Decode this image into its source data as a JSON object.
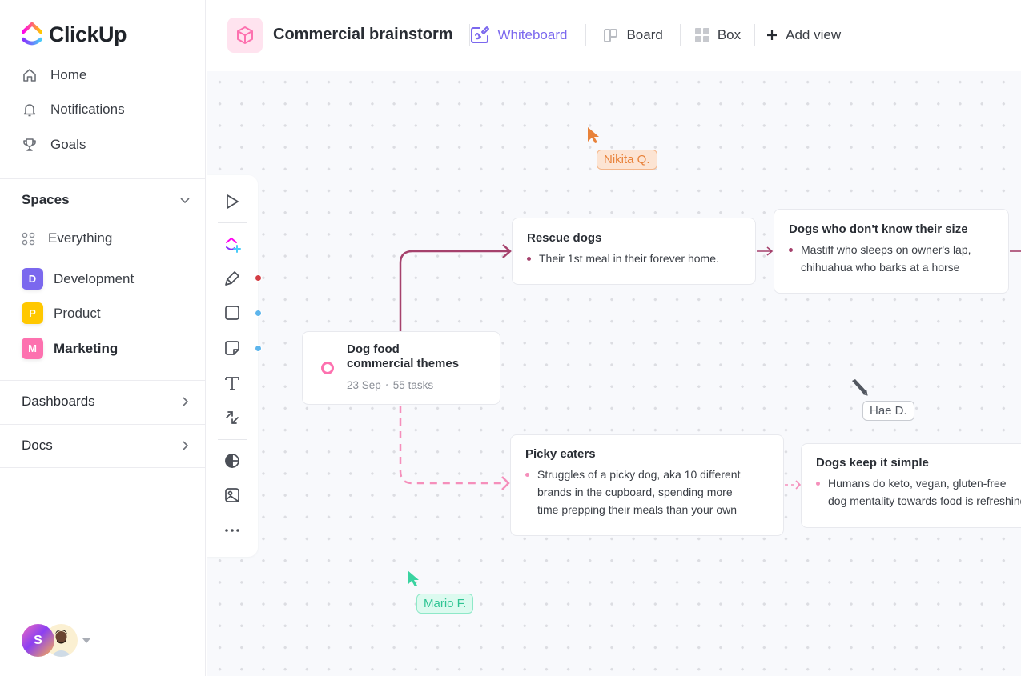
{
  "brand": {
    "name": "ClickUp"
  },
  "sidebar": {
    "nav": [
      {
        "label": "Home",
        "icon": "home-icon"
      },
      {
        "label": "Notifications",
        "icon": "bell-icon"
      },
      {
        "label": "Goals",
        "icon": "trophy-icon"
      }
    ],
    "spaces_heading": "Spaces",
    "everything_label": "Everything",
    "spaces": [
      {
        "letter": "D",
        "label": "Development",
        "color": "#7b68ee"
      },
      {
        "letter": "P",
        "label": "Product",
        "color": "#ffc800"
      },
      {
        "letter": "M",
        "label": "Marketing",
        "color": "#fd71af",
        "active": true
      }
    ],
    "sections": [
      {
        "label": "Dashboards"
      },
      {
        "label": "Docs"
      }
    ],
    "user_avatar_letter": "S"
  },
  "header": {
    "title": "Commercial brainstorm",
    "views": [
      {
        "label": "Whiteboard",
        "active": true
      },
      {
        "label": "Board"
      },
      {
        "label": "Box"
      }
    ],
    "add_view_label": "Add view"
  },
  "toolbar": {
    "tools": [
      "select",
      "clickup-add",
      "marker",
      "rectangle",
      "sticky-note",
      "text",
      "connector",
      "globe",
      "image",
      "more"
    ],
    "indicator_colors": {
      "marker": "#d33d44",
      "rectangle": "#5db5ec",
      "sticky-note": "#5db5ec"
    }
  },
  "whiteboard": {
    "root": {
      "title_line1": "Dog food",
      "title_line2": "commercial themes",
      "date": "23 Sep",
      "tasks": "55 tasks"
    },
    "cards": [
      {
        "id": "rescue",
        "title": "Rescue dogs",
        "lines": [
          "Their 1st meal in their forever home."
        ],
        "bullet_color": "#a5416c"
      },
      {
        "id": "size",
        "title": "Dogs who don't know their size",
        "lines": [
          "Mastiff who sleeps on owner's lap,",
          "chihuahua who barks at a horse"
        ],
        "bullet_color": "#a5416c"
      },
      {
        "id": "picky",
        "title": "Picky eaters",
        "lines": [
          "Struggles of a picky dog, aka 10 different",
          "brands in the cupboard, spending more",
          "time prepping their meals than your own"
        ],
        "bullet_color": "#f58fbb"
      },
      {
        "id": "simple",
        "title": "Dogs keep it simple",
        "lines": [
          "Humans do keto, vegan, gluten-free",
          "dog mentality towards food is refreshing"
        ],
        "bullet_color": "#f58fbb"
      }
    ],
    "collaborators": [
      {
        "name": "Nikita Q.",
        "color": "#e8823a",
        "bg": "#fce4d3"
      },
      {
        "name": "Hae D.",
        "color": "#525760",
        "bg": "#ffffff"
      },
      {
        "name": "Mario F.",
        "color": "#3ad3a0",
        "bg": "#dcfaef"
      }
    ],
    "connector_colors": {
      "solid": "#a5416c",
      "dashed": "#f58fbb"
    }
  }
}
